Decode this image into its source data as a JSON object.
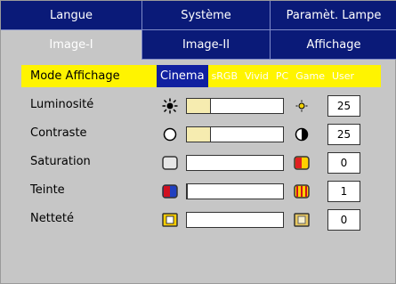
{
  "tabs_row1": [
    {
      "label": "Langue"
    },
    {
      "label": "Système"
    },
    {
      "label": "Paramèt. Lampe"
    }
  ],
  "tabs_row2": [
    {
      "label": "Image-I",
      "active": true
    },
    {
      "label": "Image-II"
    },
    {
      "label": "Affichage"
    }
  ],
  "mode": {
    "label": "Mode Affichage",
    "options": [
      "Cinema",
      "sRGB",
      "Vivid",
      "PC",
      "Game",
      "User"
    ],
    "selected": "Cinema"
  },
  "settings": [
    {
      "label": "Luminosité",
      "value": "25",
      "level_percent": 25,
      "icon_left": "sun-dim-icon",
      "icon_right": "sun-small-icon"
    },
    {
      "label": "Contraste",
      "value": "25",
      "level_percent": 25,
      "icon_left": "circle-open-icon",
      "icon_right": "half-circle-icon"
    },
    {
      "label": "Saturation",
      "value": "0",
      "level_percent": 0,
      "icon_left": "gray-square-icon",
      "icon_right": "color-square-icon"
    },
    {
      "label": "Teinte",
      "value": "1",
      "level_percent": 1,
      "icon_left": "red-blue-square-icon",
      "icon_right": "red-yellow-square-icon"
    },
    {
      "label": "Netteté",
      "value": "0",
      "level_percent": 0,
      "icon_left": "sharp-square-icon",
      "icon_right": "soft-square-icon"
    }
  ],
  "colors": {
    "tab_bg": "#0a1a78",
    "panel_bg": "#c6c6c6",
    "highlight": "#fff400",
    "selected_option": "#1020a0"
  }
}
